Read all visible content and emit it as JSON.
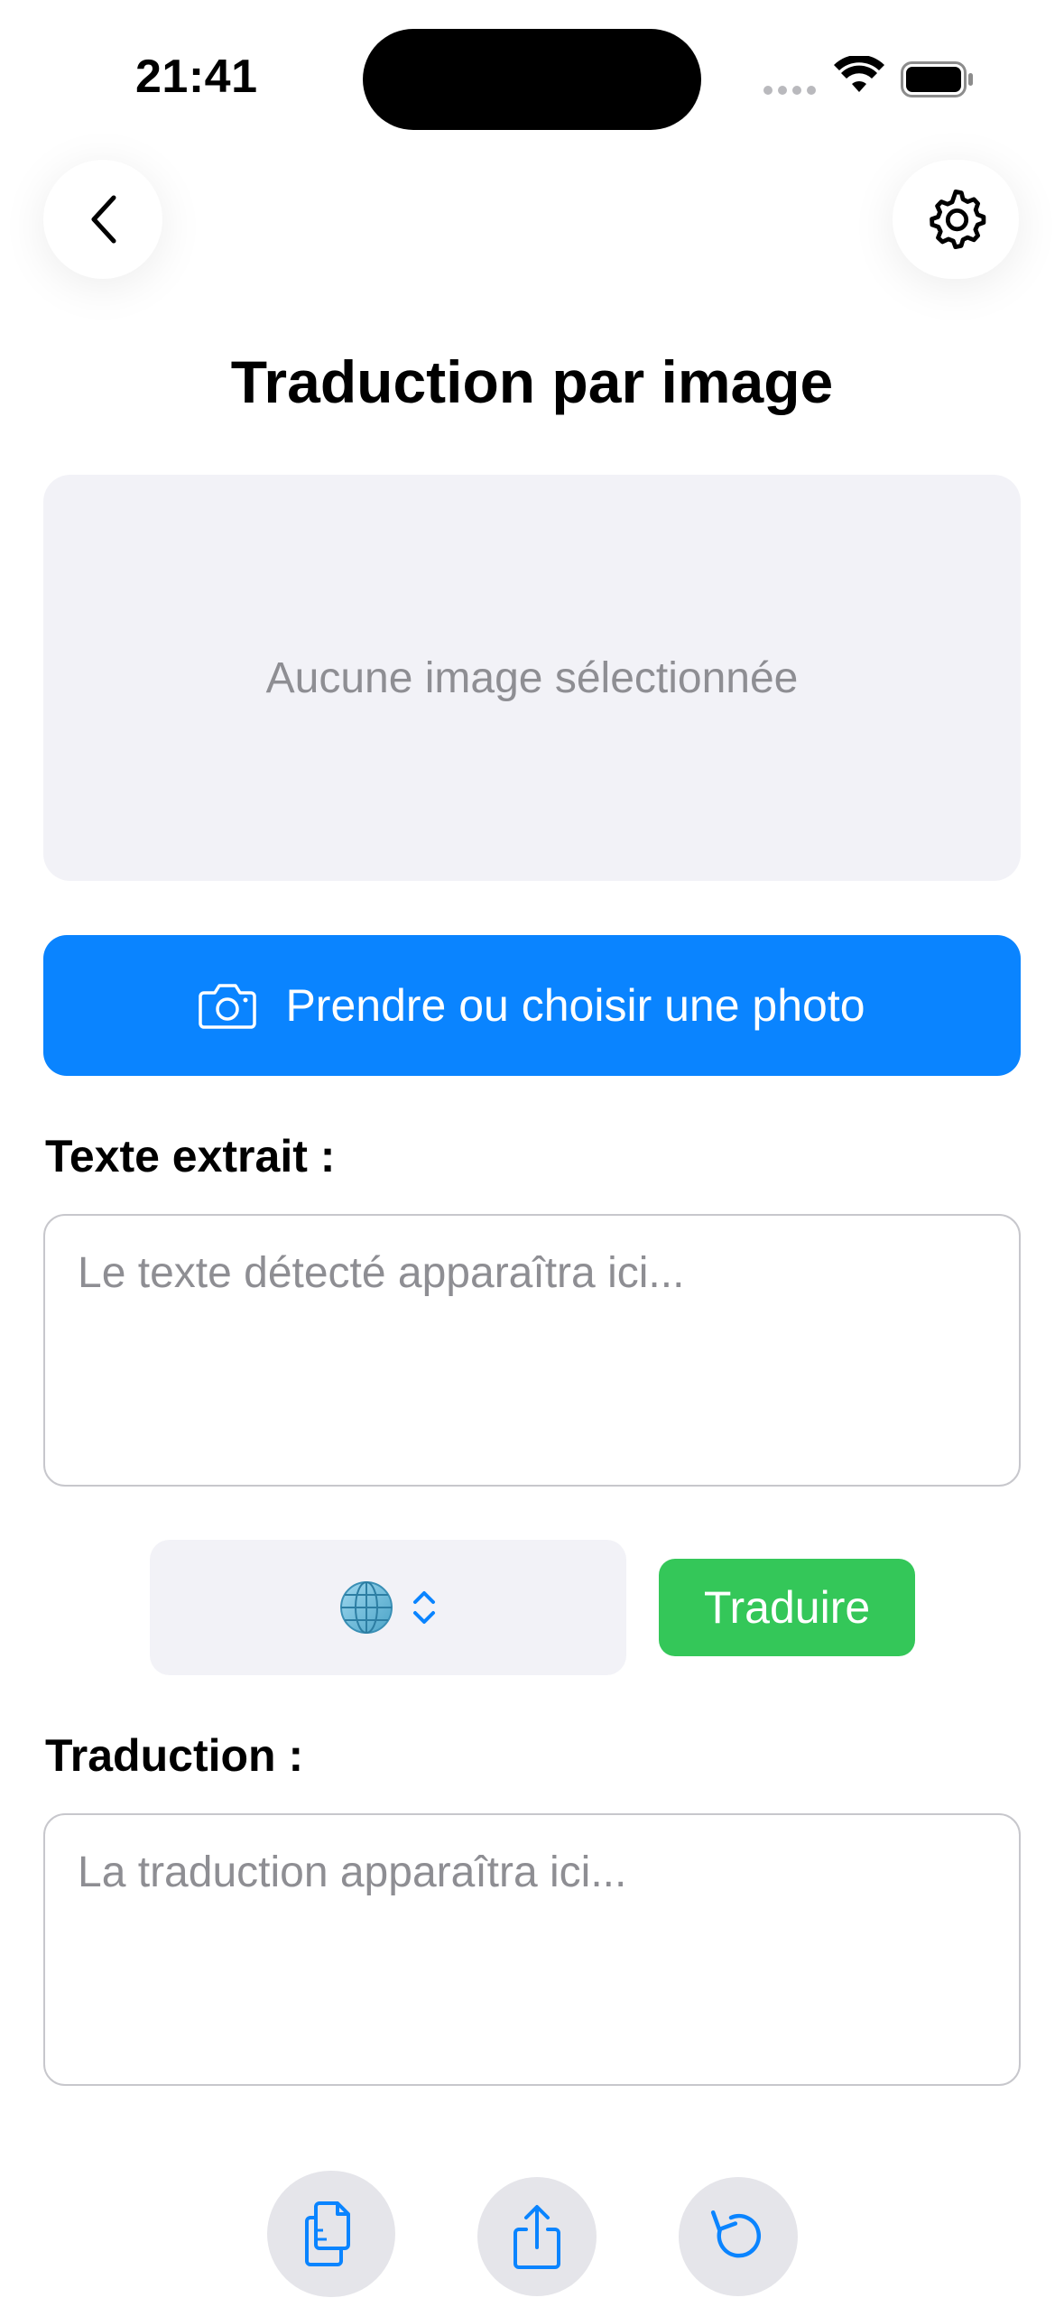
{
  "status_bar": {
    "time": "21:41"
  },
  "nav": {
    "back_icon": "chevron-left-icon",
    "settings_icon": "gear-icon"
  },
  "page": {
    "title": "Traduction par image"
  },
  "image_area": {
    "placeholder": "Aucune image sélectionnée"
  },
  "photo_button": {
    "icon": "camera-icon",
    "label": "Prendre ou choisir une photo"
  },
  "extracted": {
    "label": "Texte extrait :",
    "placeholder": "Le texte détecté apparaîtra ici..."
  },
  "language_picker": {
    "icon": "globe-icon",
    "indicator": "chevron-up-down-icon"
  },
  "translate_button": {
    "label": "Traduire"
  },
  "translation": {
    "label": "Traduction :",
    "placeholder": "La traduction apparaîtra ici..."
  },
  "actions": [
    {
      "icon": "copy-icon"
    },
    {
      "icon": "share-icon"
    },
    {
      "icon": "reset-icon"
    }
  ],
  "colors": {
    "accent_blue": "#0A84FF",
    "translate_green": "#34C759",
    "field_background": "#F2F2F7",
    "placeholder_gray": "#8E8E93"
  }
}
